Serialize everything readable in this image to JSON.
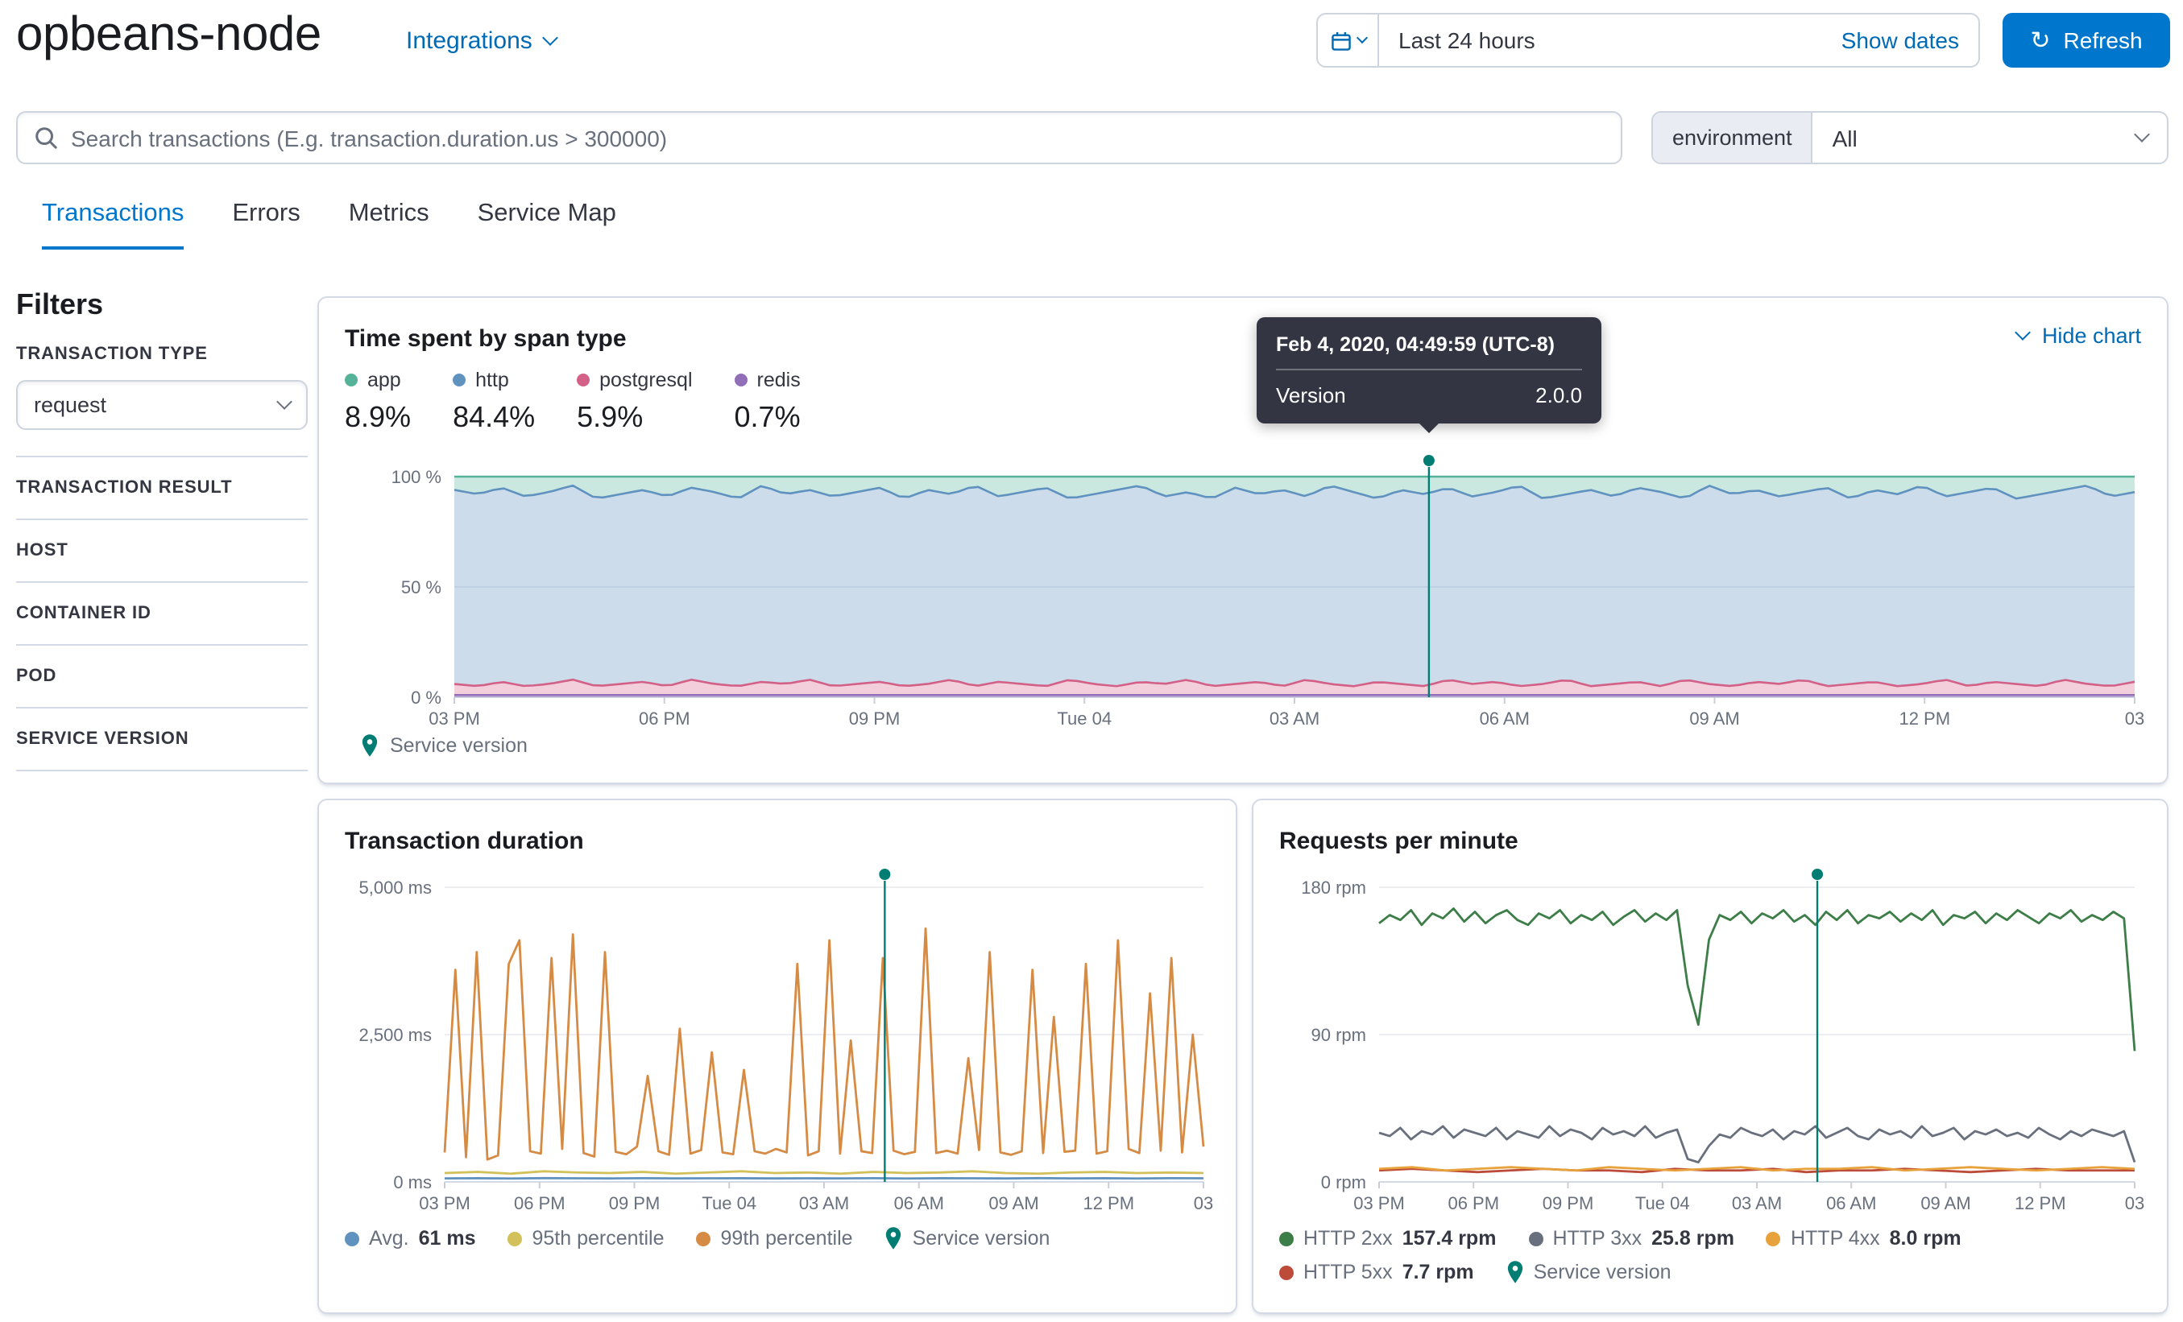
{
  "colors": {
    "accent_blue": "#0077CC",
    "link_blue": "#006BB4",
    "annotation_green": "#017D73"
  },
  "header": {
    "service_name": "opbeans-node",
    "integrations": "Integrations",
    "time_range": "Last 24 hours",
    "show_dates": "Show dates",
    "refresh": "Refresh"
  },
  "search": {
    "placeholder": "Search transactions (E.g. transaction.duration.us > 300000)",
    "environment_label": "environment",
    "environment_value": "All"
  },
  "tabs": [
    {
      "label": "Transactions",
      "active": true
    },
    {
      "label": "Errors",
      "active": false
    },
    {
      "label": "Metrics",
      "active": false
    },
    {
      "label": "Service Map",
      "active": false
    }
  ],
  "filters": {
    "title": "Filters",
    "transaction_type_label": "TRANSACTION TYPE",
    "transaction_type_value": "request",
    "sections": [
      "TRANSACTION RESULT",
      "HOST",
      "CONTAINER ID",
      "POD",
      "SERVICE VERSION"
    ]
  },
  "span_panel": {
    "hide_chart": "Hide chart",
    "service_version_label": "Service version",
    "tooltip": {
      "title": "Feb 4, 2020, 04:49:59 (UTC-8)",
      "label": "Version",
      "value": "2.0.0"
    }
  },
  "chart_data": [
    {
      "type": "area",
      "title": "Time spent by span type",
      "x_ticks": [
        "03 PM",
        "06 PM",
        "09 PM",
        "Tue 04",
        "03 AM",
        "06 AM",
        "09 AM",
        "12 PM",
        "03"
      ],
      "y_ticks": [
        {
          "label": "100 %",
          "value": 100
        },
        {
          "label": "50 %",
          "value": 50
        },
        {
          "label": "0 %",
          "value": 0
        }
      ],
      "ylim": [
        0,
        100
      ],
      "legend": [
        {
          "label": "app",
          "percent": "8.9%",
          "color": "#54B399"
        },
        {
          "label": "http",
          "percent": "84.4%",
          "color": "#6092C0"
        },
        {
          "label": "postgresql",
          "percent": "5.9%",
          "color": "#D36086"
        },
        {
          "label": "redis",
          "percent": "0.7%",
          "color": "#9170B8"
        }
      ],
      "stack": [
        {
          "name": "redis",
          "color": "#9170B8",
          "fill": "rgba(145,112,184,0.45)",
          "top": [
            1,
            1
          ]
        },
        {
          "name": "postgresql",
          "color": "#D36086",
          "fill": "rgba(211,96,134,0.30)",
          "top": [
            6,
            5,
            7,
            5,
            6,
            8,
            5,
            6,
            7,
            5,
            8,
            6,
            5,
            7,
            6,
            8,
            5,
            6,
            7,
            5,
            6,
            8,
            5,
            7,
            6,
            5,
            8,
            6,
            5,
            7,
            6,
            8,
            5,
            6,
            7,
            5,
            8,
            6,
            5,
            7,
            6,
            5,
            8,
            6,
            7,
            5,
            6,
            8,
            5,
            6,
            7,
            5,
            8,
            6,
            5,
            7,
            6,
            8,
            5,
            6,
            7,
            5,
            6,
            8,
            5,
            7,
            6,
            5,
            8,
            6,
            5,
            7
          ]
        },
        {
          "name": "http",
          "color": "#6092C0",
          "fill": "rgba(96,146,192,0.32)",
          "top": [
            94,
            92,
            95,
            91,
            93,
            96,
            90,
            92,
            94,
            91,
            95,
            93,
            90,
            96,
            92,
            94,
            91,
            93,
            95,
            90,
            94,
            92,
            96,
            91,
            93,
            95,
            90,
            92,
            94,
            96,
            91,
            93,
            90,
            95,
            92,
            94,
            91,
            96,
            93,
            90,
            94,
            92,
            95,
            91,
            93,
            96,
            90,
            92,
            94,
            91,
            95,
            93,
            90,
            96,
            92,
            94,
            91,
            93,
            95,
            90,
            94,
            92,
            96,
            91,
            93,
            95,
            90,
            92,
            94,
            96,
            91,
            93
          ]
        },
        {
          "name": "app",
          "color": "#54B399",
          "fill": "rgba(84,179,153,0.30)",
          "top": [
            100,
            100
          ]
        }
      ],
      "annotation": {
        "x_frac": 0.58,
        "color": "#017D73"
      }
    },
    {
      "type": "line",
      "title": "Transaction duration",
      "x_ticks": [
        "03 PM",
        "06 PM",
        "09 PM",
        "Tue 04",
        "03 AM",
        "06 AM",
        "09 AM",
        "12 PM",
        "03"
      ],
      "y_ticks": [
        {
          "label": "5,000 ms",
          "value": 5000
        },
        {
          "label": "2,500 ms",
          "value": 2500
        },
        {
          "label": "0 ms",
          "value": 0
        }
      ],
      "ylim": [
        0,
        5000
      ],
      "series": [
        {
          "name": "99th percentile",
          "color": "#D68B45",
          "values": [
            500,
            3600,
            420,
            3900,
            380,
            450,
            3700,
            4100,
            520,
            480,
            3800,
            560,
            4200,
            490,
            430,
            3900,
            510,
            470,
            600,
            1800,
            520,
            460,
            2600,
            480,
            540,
            2200,
            500,
            470,
            1900,
            520,
            480,
            560,
            500,
            3700,
            450,
            520,
            4100,
            480,
            2400,
            520,
            490,
            3800,
            530,
            470,
            510,
            4300,
            490,
            530,
            480,
            2100,
            540,
            3900,
            500,
            460,
            520,
            3600,
            490,
            2800,
            510,
            530,
            3700,
            480,
            520,
            4100,
            560,
            490,
            3200,
            530,
            3800,
            500,
            2500,
            600
          ]
        },
        {
          "name": "95th percentile",
          "color": "#D2C05A",
          "values": [
            150,
            170,
            140,
            180,
            160,
            150,
            170,
            140,
            160,
            180,
            150,
            160,
            140,
            170,
            150,
            160,
            180,
            150,
            140,
            160,
            170,
            150,
            160,
            150
          ]
        },
        {
          "name": "Avg.",
          "color": "#6092C0",
          "values": [
            60,
            62,
            58,
            64,
            61,
            59,
            63,
            60,
            61,
            62,
            59,
            61,
            60,
            63,
            58,
            62,
            61,
            59,
            64,
            60,
            62,
            58,
            63,
            61
          ]
        }
      ],
      "annotation": {
        "x_frac": 0.58,
        "color": "#017D73"
      },
      "legend": [
        {
          "label": "Avg.",
          "value": "61 ms",
          "color": "#6092C0"
        },
        {
          "label": "95th percentile",
          "value": "",
          "color": "#D2C05A"
        },
        {
          "label": "99th percentile",
          "value": "",
          "color": "#D68B45"
        },
        {
          "label": "Service version",
          "value": "",
          "color": "#017D73",
          "pin": true
        }
      ]
    },
    {
      "type": "line",
      "title": "Requests per minute",
      "x_ticks": [
        "03 PM",
        "06 PM",
        "09 PM",
        "Tue 04",
        "03 AM",
        "06 AM",
        "09 AM",
        "12 PM",
        "03"
      ],
      "y_ticks": [
        {
          "label": "180 rpm",
          "value": 180
        },
        {
          "label": "90 rpm",
          "value": 90
        },
        {
          "label": "0 rpm",
          "value": 0
        }
      ],
      "ylim": [
        0,
        180
      ],
      "series": [
        {
          "name": "HTTP 2xx",
          "color": "#3D7D48",
          "values": [
            158,
            163,
            160,
            166,
            157,
            164,
            161,
            167,
            159,
            165,
            158,
            163,
            166,
            160,
            157,
            164,
            161,
            166,
            158,
            163,
            160,
            165,
            157,
            162,
            166,
            159,
            164,
            160,
            166,
            120,
            96,
            148,
            163,
            160,
            165,
            158,
            164,
            161,
            166,
            159,
            163,
            157,
            165,
            160,
            166,
            158,
            163,
            161,
            165,
            159,
            164,
            160,
            166,
            157,
            163,
            161,
            165,
            158,
            164,
            160,
            166,
            162,
            158,
            164,
            161,
            166,
            159,
            163,
            160,
            165,
            161,
            80
          ]
        },
        {
          "name": "HTTP 3xx",
          "color": "#69707D",
          "values": [
            30,
            28,
            33,
            26,
            31,
            29,
            34,
            27,
            32,
            30,
            28,
            33,
            26,
            31,
            29,
            27,
            34,
            28,
            32,
            30,
            26,
            33,
            29,
            31,
            28,
            34,
            27,
            30,
            32,
            14,
            12,
            22,
            29,
            27,
            33,
            30,
            28,
            32,
            26,
            31,
            29,
            34,
            27,
            30,
            33,
            28,
            26,
            32,
            29,
            31,
            27,
            34,
            28,
            30,
            33,
            26,
            31,
            29,
            32,
            28,
            30,
            27,
            33,
            29,
            26,
            31,
            28,
            32,
            30,
            28,
            31,
            12
          ]
        },
        {
          "name": "HTTP 5xx",
          "color": "#BD4B39",
          "values": [
            7,
            8,
            7,
            6,
            7,
            8,
            7,
            7,
            6,
            8,
            7,
            7,
            8,
            6,
            7,
            7,
            8,
            7,
            6,
            7,
            8,
            7,
            7,
            7
          ]
        },
        {
          "name": "HTTP 4xx",
          "color": "#E8A23B",
          "values": [
            8,
            9,
            7,
            8,
            9,
            8,
            7,
            9,
            8,
            7,
            8,
            9,
            7,
            8,
            8,
            9,
            7,
            8,
            9,
            8,
            7,
            8,
            9,
            8
          ]
        }
      ],
      "annotation": {
        "x_frac": 0.58,
        "color": "#017D73"
      },
      "legend": [
        {
          "label": "HTTP 2xx",
          "value": "157.4 rpm",
          "color": "#3D7D48"
        },
        {
          "label": "HTTP 3xx",
          "value": "25.8 rpm",
          "color": "#69707D"
        },
        {
          "label": "HTTP 4xx",
          "value": "8.0 rpm",
          "color": "#E8A23B"
        },
        {
          "label": "HTTP 5xx",
          "value": "7.7 rpm",
          "color": "#BD4B39"
        },
        {
          "label": "Service version",
          "value": "",
          "color": "#017D73",
          "pin": true
        }
      ]
    }
  ]
}
